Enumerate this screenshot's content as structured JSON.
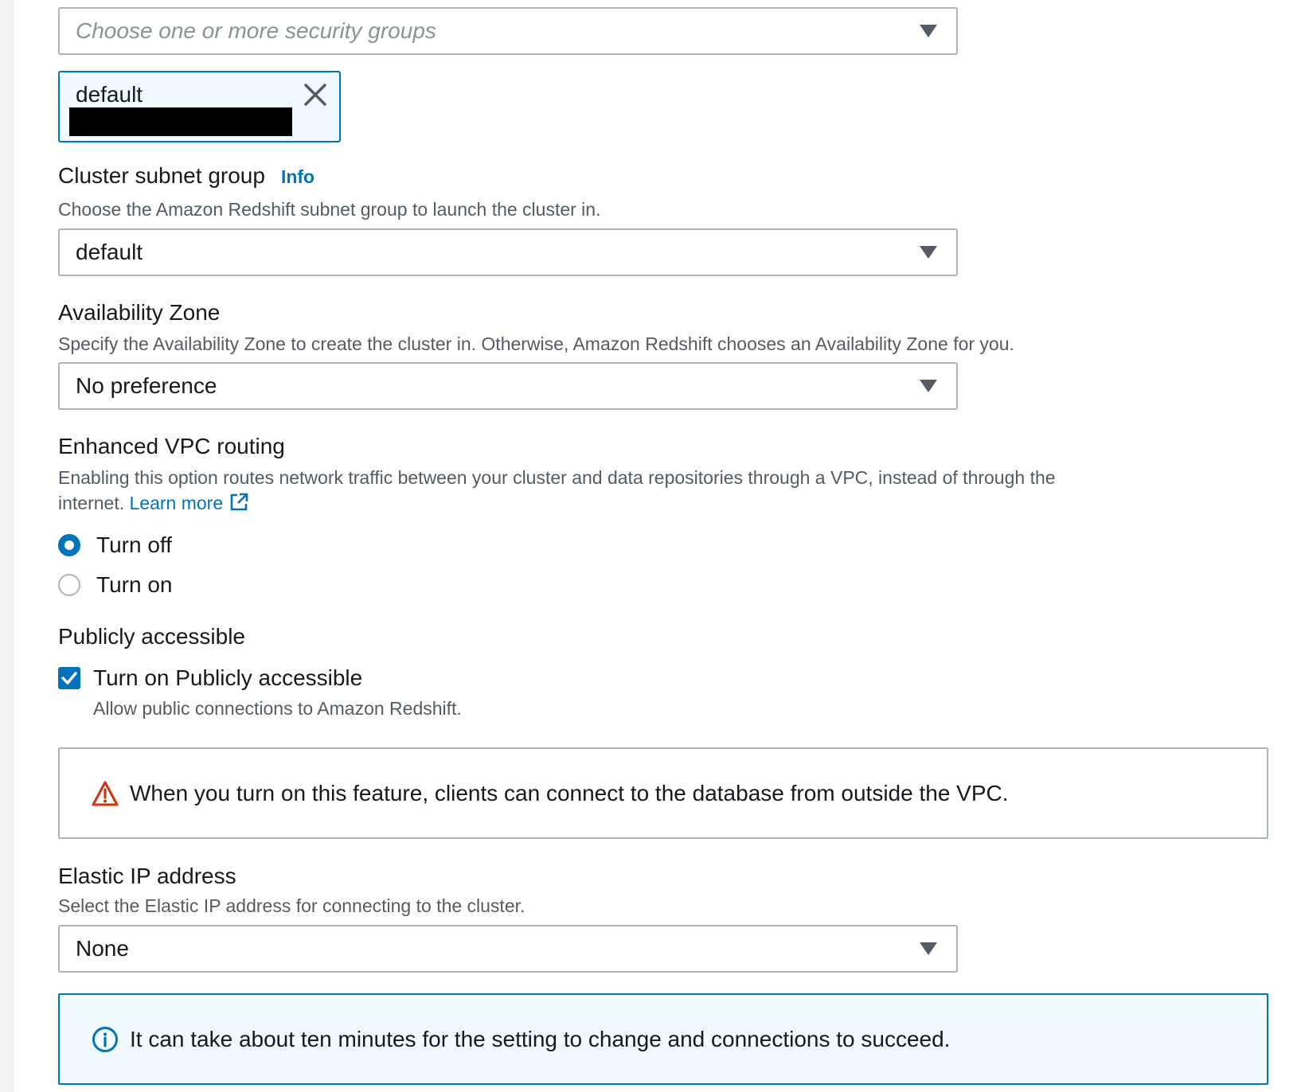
{
  "security_groups": {
    "placeholder": "Choose one or more security groups",
    "selected_token": {
      "label": "default"
    }
  },
  "cluster_subnet_group": {
    "label": "Cluster subnet group",
    "info_link": "Info",
    "description": "Choose the Amazon Redshift subnet group to launch the cluster in.",
    "value": "default"
  },
  "availability_zone": {
    "label": "Availability Zone",
    "description": "Specify the Availability Zone to create the cluster in. Otherwise, Amazon Redshift chooses an Availability Zone for you.",
    "value": "No preference"
  },
  "enhanced_vpc_routing": {
    "label": "Enhanced VPC routing",
    "description_line1": "Enabling this option routes network traffic between your cluster and data repositories through a VPC, instead of through the",
    "description_line2": "internet.",
    "learn_more": "Learn more",
    "options": [
      {
        "label": "Turn off",
        "checked": true
      },
      {
        "label": "Turn on",
        "checked": false
      }
    ]
  },
  "publicly_accessible": {
    "label": "Publicly accessible",
    "checkbox_label": "Turn on Publicly accessible",
    "checked": true,
    "description": "Allow public connections to Amazon Redshift.",
    "warning": "When you turn on this feature, clients can connect to the database from outside the VPC."
  },
  "elastic_ip": {
    "label": "Elastic IP address",
    "description": "Select the Elastic IP address for connecting to the cluster.",
    "value": "None",
    "info_alert": "It can take about ten minutes for the setting to change and connections to succeed."
  },
  "colors": {
    "accent": "#0073bb",
    "warning": "#d13212",
    "border": "#aab7b8",
    "secondary_text": "#545b64"
  }
}
